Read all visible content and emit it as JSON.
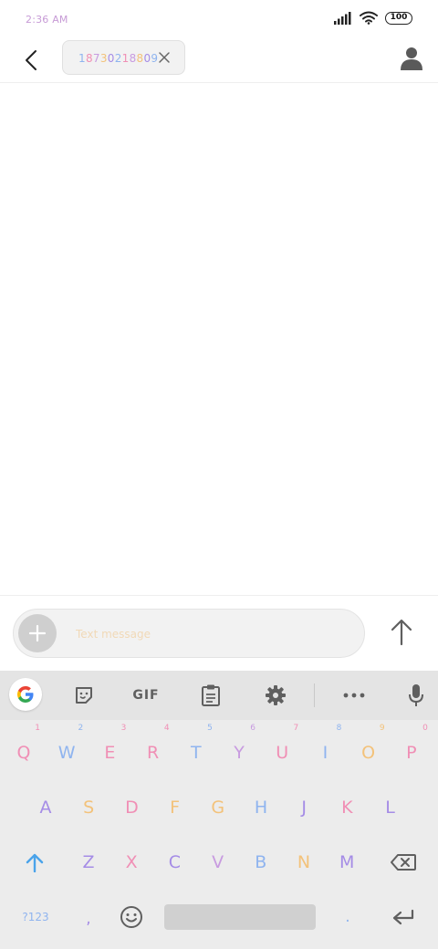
{
  "status_bar": {
    "time": "2:36 AM",
    "battery": "100",
    "icons": [
      "signal-icon",
      "wifi-icon",
      "battery-icon"
    ]
  },
  "header": {
    "recipient": "18730218809",
    "icons": [
      "back-arrow-icon",
      "close-icon",
      "contact-icon"
    ]
  },
  "compose": {
    "placeholder": "Text message",
    "icons": [
      "plus-icon",
      "send-arrow-icon"
    ]
  },
  "keyboard": {
    "toolbar": {
      "gif_label": "GIF",
      "icons": [
        "google-g-icon",
        "sticker-icon",
        "clipboard-icon",
        "gear-icon",
        "more-dots-icon",
        "microphone-icon"
      ]
    },
    "row1": [
      {
        "key": "Q",
        "hint": "1",
        "color": "#f08fb5"
      },
      {
        "key": "W",
        "hint": "2",
        "color": "#8fb4ef"
      },
      {
        "key": "E",
        "hint": "3",
        "color": "#f08fb5"
      },
      {
        "key": "R",
        "hint": "4",
        "color": "#f08fb5"
      },
      {
        "key": "T",
        "hint": "5",
        "color": "#8fb4ef"
      },
      {
        "key": "Y",
        "hint": "6",
        "color": "#c89be0"
      },
      {
        "key": "U",
        "hint": "7",
        "color": "#f08fb5"
      },
      {
        "key": "I",
        "hint": "8",
        "color": "#8fb4ef"
      },
      {
        "key": "O",
        "hint": "9",
        "color": "#f3c27a"
      },
      {
        "key": "P",
        "hint": "0",
        "color": "#f08fb5"
      }
    ],
    "row2": [
      {
        "key": "A",
        "color": "#a58ce6"
      },
      {
        "key": "S",
        "color": "#f3c27a"
      },
      {
        "key": "D",
        "color": "#f08fb5"
      },
      {
        "key": "F",
        "color": "#f3c27a"
      },
      {
        "key": "G",
        "color": "#f3c27a"
      },
      {
        "key": "H",
        "color": "#8fb4ef"
      },
      {
        "key": "J",
        "color": "#a58ce6"
      },
      {
        "key": "K",
        "color": "#f08fb5"
      },
      {
        "key": "L",
        "color": "#a58ce6"
      }
    ],
    "row3": [
      {
        "key": "Z",
        "color": "#a58ce6"
      },
      {
        "key": "X",
        "color": "#f08fb5"
      },
      {
        "key": "C",
        "color": "#a58ce6"
      },
      {
        "key": "V",
        "color": "#c89be0"
      },
      {
        "key": "B",
        "color": "#8fb4ef"
      },
      {
        "key": "N",
        "color": "#f3c27a"
      },
      {
        "key": "M",
        "color": "#a58ce6"
      }
    ],
    "row4": {
      "symbols": "?123",
      "comma": ",",
      "period": "."
    },
    "colors": {
      "shift": "#4aa3ea",
      "functional": "#616161"
    }
  }
}
